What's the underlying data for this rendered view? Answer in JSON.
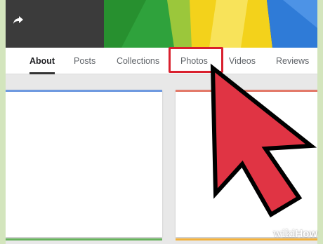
{
  "cover": {
    "colors": {
      "dark": "#3b3b3b",
      "green": "#2fa23c",
      "yellow": "#f3d21b",
      "blue": "#2f7bd7"
    }
  },
  "share_icon": "share-arrow-icon",
  "tabs": [
    {
      "label": "About",
      "active": true
    },
    {
      "label": "Posts",
      "active": false
    },
    {
      "label": "Collections",
      "active": false
    },
    {
      "label": "Photos",
      "active": false,
      "highlighted": true
    },
    {
      "label": "Videos",
      "active": false
    },
    {
      "label": "Reviews",
      "active": false
    }
  ],
  "annotation": {
    "highlight_color": "#d9202e",
    "pointer_color": "#e03444"
  },
  "cards": {
    "left_accent": "#6f9ae0",
    "right_accent": "#e37a6a"
  },
  "watermark": {
    "prefix": "wiki",
    "suffix": "How"
  }
}
